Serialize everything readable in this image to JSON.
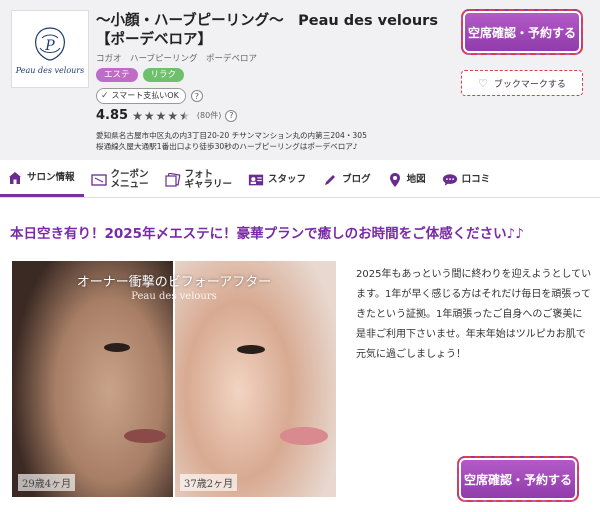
{
  "salon": {
    "title_line1": "〜小顔・ハーブピーリング〜　Peau des velours",
    "title_line2": "【ポーデベロア】",
    "subtitle": "コガオ　ハーブピーリング　ポーデベロア",
    "tags": [
      "エステ",
      "リラク"
    ],
    "payment_badge": "スマート支払いOK",
    "rating": "4.85",
    "review_count": "(80件)",
    "address_line1": "愛知県名古屋市中区丸の内3丁目20-20 チサンマンション丸の内第三204・305",
    "address_line2": "桜通線久屋大通駅1番出口より徒歩30秒のハーブピーリングはポーデベロア♪",
    "logo_text": "Peau des velours"
  },
  "buttons": {
    "reserve": "空席確認・予約する",
    "bookmark": "ブックマークする"
  },
  "tabs": [
    {
      "label": "サロン情報",
      "icon": "home-icon"
    },
    {
      "label": "クーポン\nメニュー",
      "icon": "ticket-icon"
    },
    {
      "label": "フォト\nギャラリー",
      "icon": "photo-icon"
    },
    {
      "label": "スタッフ",
      "icon": "staff-card-icon"
    },
    {
      "label": "ブログ",
      "icon": "pencil-icon"
    },
    {
      "label": "地図",
      "icon": "map-pin-icon"
    },
    {
      "label": "口コミ",
      "icon": "chat-bubble-icon"
    }
  ],
  "content": {
    "headline": "本日空き有り！2025年〆エステに！豪華プランで癒しのお時間をご体感ください♪♪",
    "photo_caption": "オーナー衝撃のビフォーアフター",
    "photo_brand": "Peau des velours",
    "age_before": "29歳4ヶ月",
    "age_after": "37歳2ヶ月",
    "description": "2025年もあっという間に終わりを迎えようとしています。1年が早く感じる方はそれだけ毎日を頑張ってきたという証拠。1年頑張ったご自身へのご褒美に是非ご利用下さいませ。年末年始はツルピカお肌で元気に過ごしましょう！"
  },
  "colors": {
    "accent_purple": "#7a2aa8",
    "button_purple": "#a24bbd",
    "dashed_red": "#e33b4a",
    "tag_esthe": "#c06cc6",
    "tag_relax": "#6fbf6d"
  }
}
